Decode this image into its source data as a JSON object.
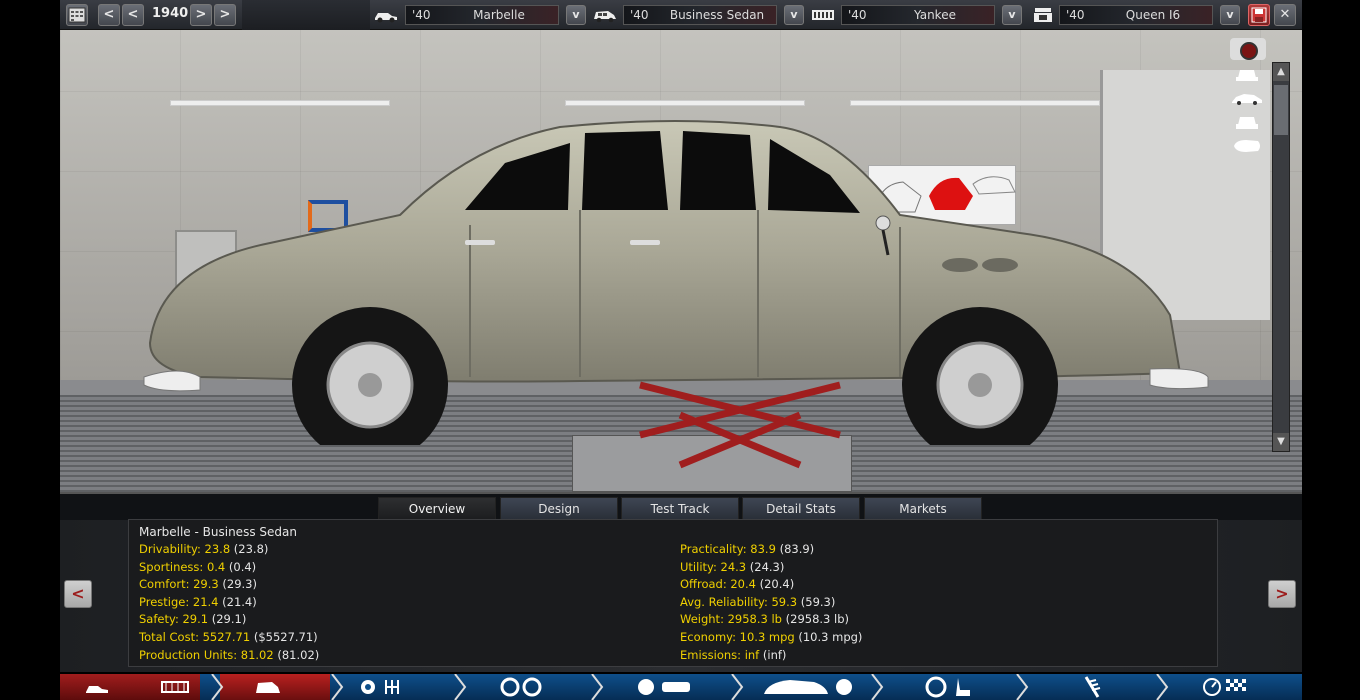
{
  "topbar": {
    "year": "1940",
    "selectors": [
      {
        "year": "'40",
        "name": "Marbelle",
        "icon": "car-chassis-icon"
      },
      {
        "year": "'40",
        "name": "Business Sedan",
        "icon": "car-body-icon"
      },
      {
        "year": "'40",
        "name": "Yankee",
        "icon": "engine-block-icon"
      },
      {
        "year": "'40",
        "name": "Queen I6",
        "icon": "engine-icon"
      }
    ],
    "dropdown_glyph": "v",
    "prev_glyph": "<",
    "next_glyph": ">",
    "save_icon": "save-icon",
    "close_glyph": "✕"
  },
  "tabs": [
    "Overview",
    "Design",
    "Test Track",
    "Detail Stats",
    "Markets"
  ],
  "active_tab": "Overview",
  "stats": {
    "title": "Marbelle - Business Sedan",
    "left": [
      {
        "label": "Drivability: 23.8",
        "paren": "(23.8)"
      },
      {
        "label": "Sportiness: 0.4",
        "paren": "(0.4)"
      },
      {
        "label": "Comfort: 29.3",
        "paren": "(29.3)"
      },
      {
        "label": "Prestige: 21.4",
        "paren": "(21.4)"
      },
      {
        "label": "Safety: 29.1",
        "paren": "(29.1)"
      },
      {
        "label": "Total Cost: 5527.71",
        "paren": "($5527.71)"
      },
      {
        "label": "Production Units: 81.02",
        "paren": "(81.02)"
      }
    ],
    "right": [
      {
        "label": "Practicality: 83.9",
        "paren": "(83.9)"
      },
      {
        "label": "Utility: 24.3",
        "paren": "(24.3)"
      },
      {
        "label": "Offroad: 20.4",
        "paren": "(20.4)"
      },
      {
        "label": "Avg. Reliability: 59.3",
        "paren": "(59.3)"
      },
      {
        "label": "Weight: 2958.3 lb",
        "paren": "(2958.3 lb)"
      },
      {
        "label": "Economy: 10.3 mpg",
        "paren": "(10.3 mpg)"
      },
      {
        "label": "Emissions: inf",
        "paren": "(inf)"
      }
    ]
  },
  "nav": {
    "prev_glyph": "<",
    "next_glyph": ">"
  },
  "bottom_nav_icons": [
    "car-chassis-icon",
    "chassis-frame-icon",
    "car-body-icon",
    "engine-gearbox-icon",
    "wheels-icon",
    "brakes-icon",
    "car-fan-icon",
    "steering-seat-icon",
    "suspension-icon",
    "gauge-finish-icon"
  ],
  "colors": {
    "stat_label": "#f0d000",
    "accent_red": "#b23a3a",
    "nav_blue": "#0e4f8a"
  }
}
